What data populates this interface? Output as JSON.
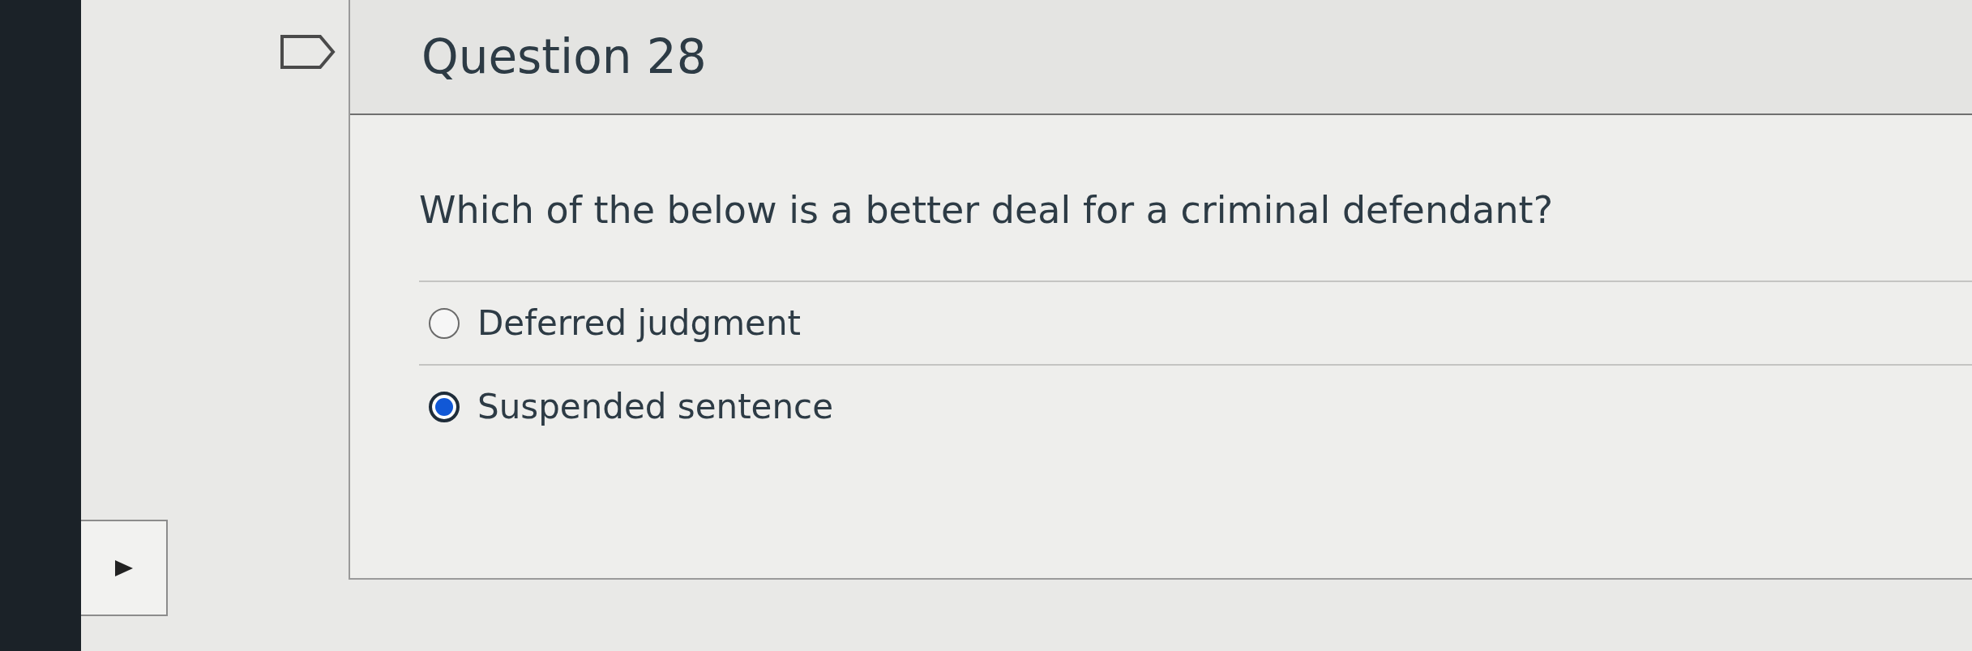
{
  "question": {
    "title": "Question 28",
    "prompt": "Which of the below is a better deal for a criminal defendant?",
    "options": [
      {
        "label": "Deferred judgment",
        "selected": false
      },
      {
        "label": "Suspended sentence",
        "selected": true
      }
    ]
  }
}
